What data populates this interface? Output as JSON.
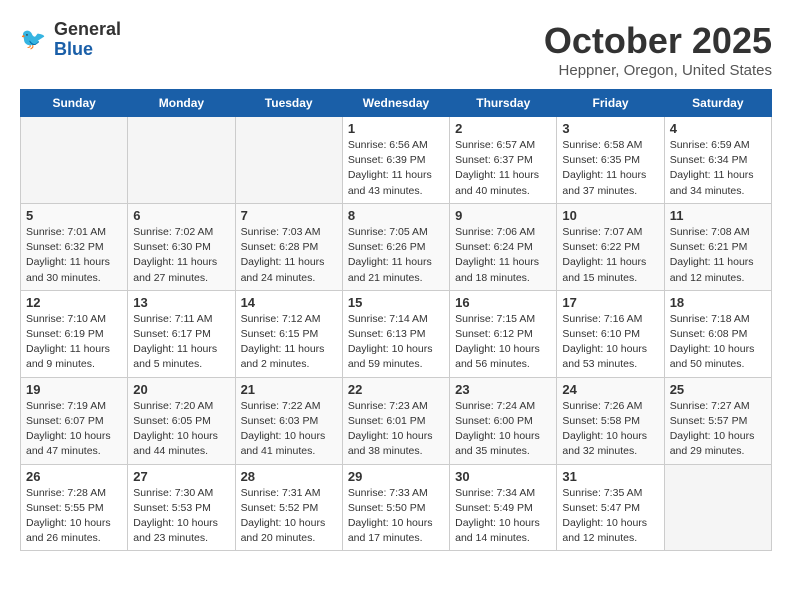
{
  "header": {
    "logo_line1": "General",
    "logo_line2": "Blue",
    "month": "October 2025",
    "location": "Heppner, Oregon, United States"
  },
  "weekdays": [
    "Sunday",
    "Monday",
    "Tuesday",
    "Wednesday",
    "Thursday",
    "Friday",
    "Saturday"
  ],
  "weeks": [
    [
      {
        "day": "",
        "empty": true
      },
      {
        "day": "",
        "empty": true
      },
      {
        "day": "",
        "empty": true
      },
      {
        "day": "1",
        "sunrise": "Sunrise: 6:56 AM",
        "sunset": "Sunset: 6:39 PM",
        "daylight": "Daylight: 11 hours and 43 minutes."
      },
      {
        "day": "2",
        "sunrise": "Sunrise: 6:57 AM",
        "sunset": "Sunset: 6:37 PM",
        "daylight": "Daylight: 11 hours and 40 minutes."
      },
      {
        "day": "3",
        "sunrise": "Sunrise: 6:58 AM",
        "sunset": "Sunset: 6:35 PM",
        "daylight": "Daylight: 11 hours and 37 minutes."
      },
      {
        "day": "4",
        "sunrise": "Sunrise: 6:59 AM",
        "sunset": "Sunset: 6:34 PM",
        "daylight": "Daylight: 11 hours and 34 minutes."
      }
    ],
    [
      {
        "day": "5",
        "sunrise": "Sunrise: 7:01 AM",
        "sunset": "Sunset: 6:32 PM",
        "daylight": "Daylight: 11 hours and 30 minutes."
      },
      {
        "day": "6",
        "sunrise": "Sunrise: 7:02 AM",
        "sunset": "Sunset: 6:30 PM",
        "daylight": "Daylight: 11 hours and 27 minutes."
      },
      {
        "day": "7",
        "sunrise": "Sunrise: 7:03 AM",
        "sunset": "Sunset: 6:28 PM",
        "daylight": "Daylight: 11 hours and 24 minutes."
      },
      {
        "day": "8",
        "sunrise": "Sunrise: 7:05 AM",
        "sunset": "Sunset: 6:26 PM",
        "daylight": "Daylight: 11 hours and 21 minutes."
      },
      {
        "day": "9",
        "sunrise": "Sunrise: 7:06 AM",
        "sunset": "Sunset: 6:24 PM",
        "daylight": "Daylight: 11 hours and 18 minutes."
      },
      {
        "day": "10",
        "sunrise": "Sunrise: 7:07 AM",
        "sunset": "Sunset: 6:22 PM",
        "daylight": "Daylight: 11 hours and 15 minutes."
      },
      {
        "day": "11",
        "sunrise": "Sunrise: 7:08 AM",
        "sunset": "Sunset: 6:21 PM",
        "daylight": "Daylight: 11 hours and 12 minutes."
      }
    ],
    [
      {
        "day": "12",
        "sunrise": "Sunrise: 7:10 AM",
        "sunset": "Sunset: 6:19 PM",
        "daylight": "Daylight: 11 hours and 9 minutes."
      },
      {
        "day": "13",
        "sunrise": "Sunrise: 7:11 AM",
        "sunset": "Sunset: 6:17 PM",
        "daylight": "Daylight: 11 hours and 5 minutes."
      },
      {
        "day": "14",
        "sunrise": "Sunrise: 7:12 AM",
        "sunset": "Sunset: 6:15 PM",
        "daylight": "Daylight: 11 hours and 2 minutes."
      },
      {
        "day": "15",
        "sunrise": "Sunrise: 7:14 AM",
        "sunset": "Sunset: 6:13 PM",
        "daylight": "Daylight: 10 hours and 59 minutes."
      },
      {
        "day": "16",
        "sunrise": "Sunrise: 7:15 AM",
        "sunset": "Sunset: 6:12 PM",
        "daylight": "Daylight: 10 hours and 56 minutes."
      },
      {
        "day": "17",
        "sunrise": "Sunrise: 7:16 AM",
        "sunset": "Sunset: 6:10 PM",
        "daylight": "Daylight: 10 hours and 53 minutes."
      },
      {
        "day": "18",
        "sunrise": "Sunrise: 7:18 AM",
        "sunset": "Sunset: 6:08 PM",
        "daylight": "Daylight: 10 hours and 50 minutes."
      }
    ],
    [
      {
        "day": "19",
        "sunrise": "Sunrise: 7:19 AM",
        "sunset": "Sunset: 6:07 PM",
        "daylight": "Daylight: 10 hours and 47 minutes."
      },
      {
        "day": "20",
        "sunrise": "Sunrise: 7:20 AM",
        "sunset": "Sunset: 6:05 PM",
        "daylight": "Daylight: 10 hours and 44 minutes."
      },
      {
        "day": "21",
        "sunrise": "Sunrise: 7:22 AM",
        "sunset": "Sunset: 6:03 PM",
        "daylight": "Daylight: 10 hours and 41 minutes."
      },
      {
        "day": "22",
        "sunrise": "Sunrise: 7:23 AM",
        "sunset": "Sunset: 6:01 PM",
        "daylight": "Daylight: 10 hours and 38 minutes."
      },
      {
        "day": "23",
        "sunrise": "Sunrise: 7:24 AM",
        "sunset": "Sunset: 6:00 PM",
        "daylight": "Daylight: 10 hours and 35 minutes."
      },
      {
        "day": "24",
        "sunrise": "Sunrise: 7:26 AM",
        "sunset": "Sunset: 5:58 PM",
        "daylight": "Daylight: 10 hours and 32 minutes."
      },
      {
        "day": "25",
        "sunrise": "Sunrise: 7:27 AM",
        "sunset": "Sunset: 5:57 PM",
        "daylight": "Daylight: 10 hours and 29 minutes."
      }
    ],
    [
      {
        "day": "26",
        "sunrise": "Sunrise: 7:28 AM",
        "sunset": "Sunset: 5:55 PM",
        "daylight": "Daylight: 10 hours and 26 minutes."
      },
      {
        "day": "27",
        "sunrise": "Sunrise: 7:30 AM",
        "sunset": "Sunset: 5:53 PM",
        "daylight": "Daylight: 10 hours and 23 minutes."
      },
      {
        "day": "28",
        "sunrise": "Sunrise: 7:31 AM",
        "sunset": "Sunset: 5:52 PM",
        "daylight": "Daylight: 10 hours and 20 minutes."
      },
      {
        "day": "29",
        "sunrise": "Sunrise: 7:33 AM",
        "sunset": "Sunset: 5:50 PM",
        "daylight": "Daylight: 10 hours and 17 minutes."
      },
      {
        "day": "30",
        "sunrise": "Sunrise: 7:34 AM",
        "sunset": "Sunset: 5:49 PM",
        "daylight": "Daylight: 10 hours and 14 minutes."
      },
      {
        "day": "31",
        "sunrise": "Sunrise: 7:35 AM",
        "sunset": "Sunset: 5:47 PM",
        "daylight": "Daylight: 10 hours and 12 minutes."
      },
      {
        "day": "",
        "empty": true
      }
    ]
  ]
}
